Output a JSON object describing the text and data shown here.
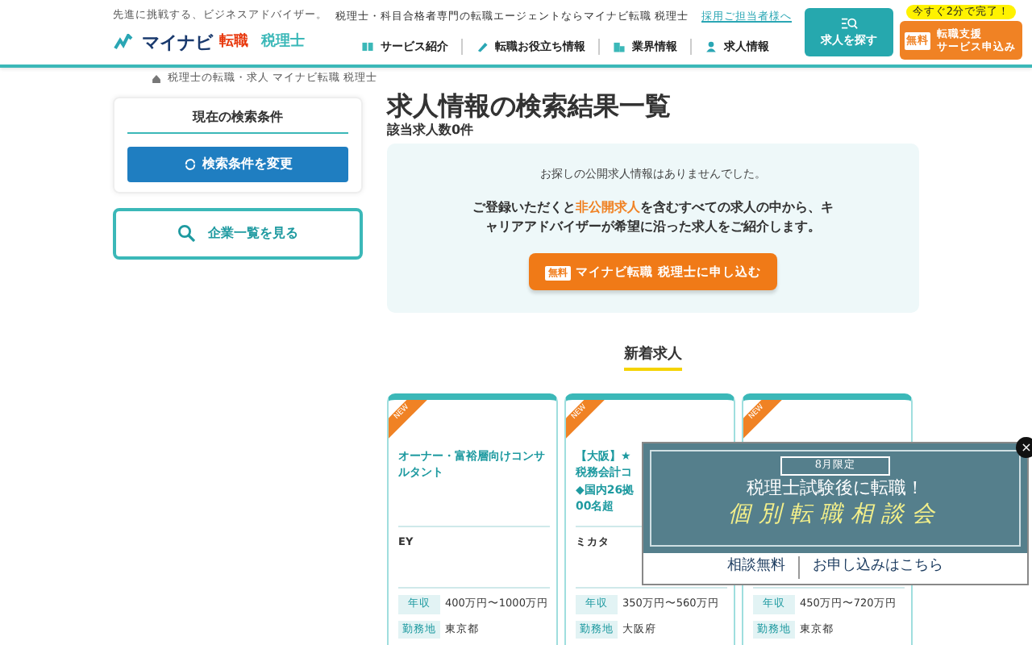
{
  "header": {
    "tagline": "先進に挑戦する、ビジネスアドバイザー。",
    "logo_main": "マイナビ",
    "logo_sub": "転職",
    "logo_brand": "税理士",
    "lead": "税理士・科目合格者専門の転職エージェントならマイナビ転職 税理士",
    "recruiter_link": "採用ご担当者様へ",
    "nav": [
      {
        "label": "サービス紹介"
      },
      {
        "label": "転職お役立ち情報"
      },
      {
        "label": "業界情報"
      },
      {
        "label": "求人情報"
      }
    ],
    "search_button": "求人を探す",
    "apply_badge": "今すぐ2分で完了！",
    "apply_free": "無料",
    "apply_lines": [
      "転職支援",
      "サービス申込み"
    ]
  },
  "breadcrumb": "税理士の転職・求人 マイナビ転職 税理士",
  "sidebar": {
    "title": "現在の検索条件",
    "change_button": "検索条件を変更",
    "company_button": "企業一覧を見る"
  },
  "main": {
    "title": "求人情報の検索結果一覧",
    "count": "該当求人数0件",
    "notice": "お探しの公開求人情報はありませんでした。",
    "message": "ご登録いただくと**非公開求人**を含むすべての求人の中から、キャリアアドバイザーが希望に沿った求人をご紹介します。",
    "cta_free": "無料",
    "cta": "マイナビ転職 税理士に申し込む"
  },
  "new_jobs": {
    "heading": "新着求人",
    "cards": [
      {
        "badge": "NEW",
        "title": "オーナー・富裕層向けコンサルタント",
        "company": "EY",
        "salary_label": "年収",
        "salary": "400万円〜1000万円",
        "location_label": "勤務地",
        "location": "東京都"
      },
      {
        "badge": "NEW",
        "title": "【大阪】★\n税務会計コ\n◆国内26拠\n00名超",
        "company": "ミカタ",
        "salary_label": "年収",
        "salary": "350万円〜560万円",
        "location_label": "勤務地",
        "location": "大阪府"
      },
      {
        "badge": "NEW",
        "salary_label": "年収",
        "salary": "450万円〜720万円",
        "location_label": "勤務地",
        "location": "東京都"
      }
    ]
  },
  "popup": {
    "tag": "8月限定",
    "headline": "税理士試験後に転職！",
    "title": "個別転職相談会",
    "footer_left": "相談無料",
    "footer_right": "お申し込みはこちら",
    "close": "×"
  }
}
